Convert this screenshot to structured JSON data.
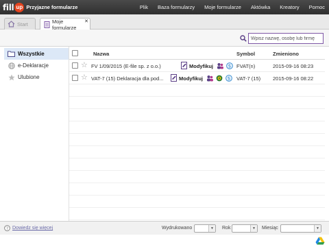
{
  "app": {
    "logo_text": "fill",
    "logo_badge": "up",
    "tagline": "Przyjazne formularze"
  },
  "menu": [
    "Plik",
    "Baza formularzy",
    "Moje formularze",
    "Aktówka",
    "Kreatory",
    "Pomoc"
  ],
  "tabs": [
    {
      "label": "Start",
      "active": false
    },
    {
      "label": "Moje formularze",
      "active": true,
      "closable": true
    }
  ],
  "search": {
    "placeholder": "Wpisz nazwę, osobę lub firmę"
  },
  "sidebar": {
    "items": [
      {
        "label": "Wszystkie",
        "icon": "folder-icon",
        "active": true
      },
      {
        "label": "e-Deklaracje",
        "icon": "globe-icon",
        "active": false
      },
      {
        "label": "Ulubione",
        "icon": "star-icon",
        "active": false
      }
    ]
  },
  "table": {
    "columns": {
      "name": "Nazwa",
      "symbol": "Symbol",
      "modified": "Zmieniono"
    },
    "rows": [
      {
        "name": "FV 1/09/2015 (E-file sp. z o.o.)",
        "action": "Modyfikuj",
        "symbol": "FVAT(n)",
        "modified": "2015-09-16 08:23"
      },
      {
        "name": "VAT-7 (15) Deklaracja dla pod...",
        "action": "Modyfikuj",
        "symbol": "VAT-7 (15)",
        "modified": "2015-09-16 08:22"
      }
    ]
  },
  "footer": {
    "help_link": "Dowiedz się więcej",
    "printed_label": "Wydrukowano",
    "year_label": "Rok",
    "month_label": "Miesiąc"
  },
  "colors": {
    "topbar": "#3a3a3a",
    "accent_purple": "#7e57a6",
    "active_sidebar": "#dce8f7"
  }
}
